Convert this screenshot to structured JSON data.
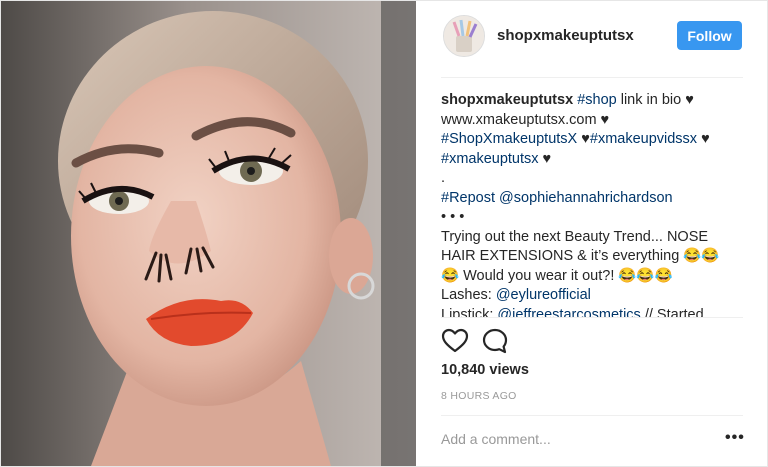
{
  "post": {
    "username": "shopxmakeuptutsx",
    "follow_label": "Follow",
    "caption": [
      [
        {
          "t": "shopxmakeuptutsx",
          "c": "user"
        },
        {
          "t": " "
        },
        {
          "t": "#shop",
          "c": "link"
        },
        {
          "t": " link in bio ♥"
        }
      ],
      [
        {
          "t": "www.xmakeuptutsx.com ♥"
        }
      ],
      [
        {
          "t": "#ShopXmakeuptutsX",
          "c": "link"
        },
        {
          "t": " ♥"
        },
        {
          "t": "#xmakeupvidssx",
          "c": "link"
        },
        {
          "t": " ♥"
        }
      ],
      [
        {
          "t": "#xmakeuptutsx",
          "c": "link"
        },
        {
          "t": " ♥"
        }
      ],
      [
        {
          "t": "."
        }
      ],
      [
        {
          "t": "#Repost",
          "c": "link"
        },
        {
          "t": " "
        },
        {
          "t": "@sophiehannahrichardson",
          "c": "link"
        }
      ],
      [
        {
          "t": "•  •  •"
        }
      ],
      [
        {
          "t": "Trying out the next Beauty Trend... NOSE"
        }
      ],
      [
        {
          "t": "HAIR EXTENSIONS & it’s everything 😂😂"
        }
      ],
      [
        {
          "t": "😂 Would you wear it out?! 😂😂😂"
        }
      ],
      [
        {
          "t": "Lashes: "
        },
        {
          "t": "@eylureofficial",
          "c": "link"
        }
      ],
      [
        {
          "t": "Lipstick: "
        },
        {
          "t": "@jeffreestarcosmetics",
          "c": "link"
        },
        {
          "t": " // Started"
        }
      ]
    ],
    "views": "10,840 views",
    "timestamp": "8 HOURS AGO",
    "comment_placeholder": "Add a comment...",
    "more_label": "•••",
    "icons": {
      "like": "heart-icon",
      "comment": "comment-icon",
      "options": "more-options-icon"
    },
    "colors": {
      "follow_button": "#3897f0",
      "link": "#003569",
      "muted": "#999999"
    }
  }
}
